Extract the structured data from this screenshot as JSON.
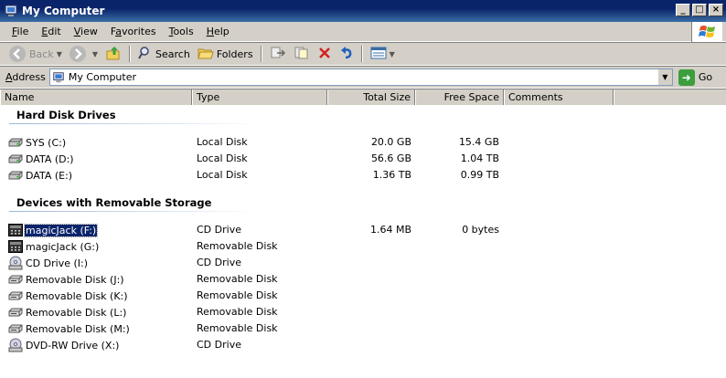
{
  "window": {
    "title": "My Computer"
  },
  "window_buttons": {
    "minimize": "_",
    "maximize": "□",
    "close": "×"
  },
  "menu": [
    {
      "pre": "",
      "ul": "F",
      "post": "ile"
    },
    {
      "pre": "",
      "ul": "E",
      "post": "dit"
    },
    {
      "pre": "",
      "ul": "V",
      "post": "iew"
    },
    {
      "pre": "F",
      "ul": "a",
      "post": "vorites"
    },
    {
      "pre": "",
      "ul": "T",
      "post": "ools"
    },
    {
      "pre": "",
      "ul": "H",
      "post": "elp"
    }
  ],
  "toolbar": {
    "back_label": "Back",
    "search_label": "Search",
    "folders_label": "Folders"
  },
  "address": {
    "label_ul": "A",
    "label_rest": "ddress",
    "value": "My Computer",
    "go_label": "Go"
  },
  "columns": {
    "name": "Name",
    "type": "Type",
    "total": "Total Size",
    "free": "Free Space",
    "comments": "Comments"
  },
  "groups": {
    "hdd": "Hard Disk Drives",
    "removable": "Devices with Removable Storage"
  },
  "hdd_rows": [
    {
      "name": "SYS (C:)",
      "type": "Local Disk",
      "total": "20.0 GB",
      "free": "15.4 GB"
    },
    {
      "name": "DATA (D:)",
      "type": "Local Disk",
      "total": "56.6 GB",
      "free": "1.04 TB"
    },
    {
      "name": "DATA (E:)",
      "type": "Local Disk",
      "total": "1.36 TB",
      "free": "0.99 TB"
    }
  ],
  "removable_rows": [
    {
      "name": "magicJack (F:)",
      "type": "CD Drive",
      "total": "1.64 MB",
      "free": "0 bytes",
      "icon": "magicjack-icon",
      "selected": true
    },
    {
      "name": "magicJack (G:)",
      "type": "Removable Disk",
      "total": "",
      "free": "",
      "icon": "magicjack-icon"
    },
    {
      "name": "CD Drive (I:)",
      "type": "CD Drive",
      "total": "",
      "free": "",
      "icon": "cd-drive-icon"
    },
    {
      "name": "Removable Disk (J:)",
      "type": "Removable Disk",
      "total": "",
      "free": "",
      "icon": "removable-disk-icon"
    },
    {
      "name": "Removable Disk (K:)",
      "type": "Removable Disk",
      "total": "",
      "free": "",
      "icon": "removable-disk-icon"
    },
    {
      "name": "Removable Disk (L:)",
      "type": "Removable Disk",
      "total": "",
      "free": "",
      "icon": "removable-disk-icon"
    },
    {
      "name": "Removable Disk (M:)",
      "type": "Removable Disk",
      "total": "",
      "free": "",
      "icon": "removable-disk-icon"
    },
    {
      "name": "DVD-RW Drive (X:)",
      "type": "CD Drive",
      "total": "",
      "free": "",
      "icon": "dvd-drive-icon"
    }
  ],
  "colors": {
    "titlebar": "#0a246a",
    "selection": "#0a246a",
    "chrome": "#d4d0c8"
  }
}
